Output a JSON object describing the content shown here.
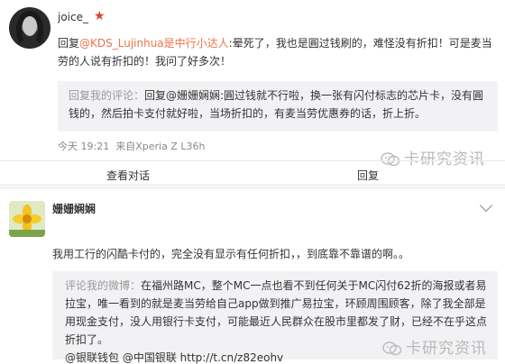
{
  "post1": {
    "username": "joice_",
    "reply_prefix": "回复",
    "reply_mention": "@KDS_Lujinhua是中行小达人",
    "reply_text": ":晕死了，我也是圓过钱刷的，难怪没有折扣！可是麦当劳的人说有折扣的！我问了好多次！",
    "quote_label": "回复我的评论：",
    "quote_text": "回复@姗姗娴娴:圓过钱就不行啦，换一张有闪付标志的芯片卡，没有圓钱的，然后拍卡支付就好啦，当场折扣的，有麦当劳优惠券的话，折上折。",
    "timestamp": "今天 19:21",
    "source": "来自Xperia Z L36h",
    "action_view": "查看对话",
    "action_reply": "回复"
  },
  "watermark": "卡研究资讯",
  "post2": {
    "username": "姗姗娴娴",
    "text": "我用工行的闪酷卡付的，完全没有显示有任何折扣，，到底靠不靠谱的啊。。",
    "quote_label": "评论我的微博：",
    "quote_text": "在福州路MC，整个MC一点也看不到任何关于MC闪付62折的海报或者易拉宝，唯一看到的就是麦当劳给自己app做到推广易拉宝，环顾周围顾客，除了我全部是用现金支付，没人用银行卡支付，可能最近人民群众在股市里都发了财，已经不在乎这点折扣了。",
    "quote_links": "@银联钱包 @中国银联 http://t.cn/z82eohv"
  },
  "colors": {
    "mention": "#eb7350",
    "star": "#e0422b",
    "quote_bg": "#f2f2f5",
    "watermark": "#b9b9b9"
  }
}
